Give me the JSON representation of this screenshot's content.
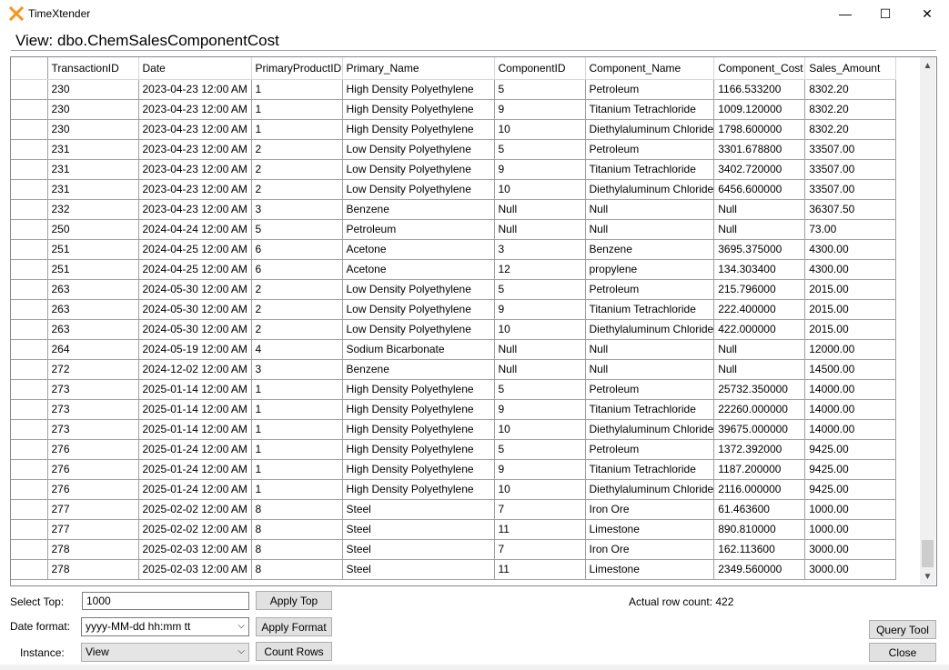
{
  "window": {
    "app_title": "TimeXtender",
    "minimize_glyph": "—",
    "maximize_glyph": "☐",
    "close_glyph": "✕",
    "logo_icon": "timextender-x-logo",
    "logo_color": "#f7941d"
  },
  "view": {
    "title": "View: dbo.ChemSalesComponentCost"
  },
  "grid": {
    "columns": [
      "TransactionID",
      "Date",
      "PrimaryProductID",
      "Primary_Name",
      "ComponentID",
      "Component_Name",
      "Component_Cost",
      "Sales_Amount"
    ],
    "rows": [
      [
        "230",
        "2023-04-23 12:00 AM",
        "1",
        "High Density Polyethylene",
        "5",
        "Petroleum",
        "1166.533200",
        "8302.20"
      ],
      [
        "230",
        "2023-04-23 12:00 AM",
        "1",
        "High Density Polyethylene",
        "9",
        "Titanium Tetrachloride",
        "1009.120000",
        "8302.20"
      ],
      [
        "230",
        "2023-04-23 12:00 AM",
        "1",
        "High Density Polyethylene",
        "10",
        "Diethylaluminum Chloride",
        "1798.600000",
        "8302.20"
      ],
      [
        "231",
        "2023-04-23 12:00 AM",
        "2",
        "Low Density Polyethylene",
        "5",
        "Petroleum",
        "3301.678800",
        "33507.00"
      ],
      [
        "231",
        "2023-04-23 12:00 AM",
        "2",
        "Low Density Polyethylene",
        "9",
        "Titanium Tetrachloride",
        "3402.720000",
        "33507.00"
      ],
      [
        "231",
        "2023-04-23 12:00 AM",
        "2",
        "Low Density Polyethylene",
        "10",
        "Diethylaluminum Chloride",
        "6456.600000",
        "33507.00"
      ],
      [
        "232",
        "2023-04-23 12:00 AM",
        "3",
        "Benzene",
        "Null",
        "Null",
        "Null",
        "36307.50"
      ],
      [
        "250",
        "2024-04-24 12:00 AM",
        "5",
        "Petroleum",
        "Null",
        "Null",
        "Null",
        "73.00"
      ],
      [
        "251",
        "2024-04-25 12:00 AM",
        "6",
        "Acetone",
        "3",
        "Benzene",
        "3695.375000",
        "4300.00"
      ],
      [
        "251",
        "2024-04-25 12:00 AM",
        "6",
        "Acetone",
        "12",
        "propylene",
        "134.303400",
        "4300.00"
      ],
      [
        "263",
        "2024-05-30 12:00 AM",
        "2",
        "Low Density Polyethylene",
        "5",
        "Petroleum",
        "215.796000",
        "2015.00"
      ],
      [
        "263",
        "2024-05-30 12:00 AM",
        "2",
        "Low Density Polyethylene",
        "9",
        "Titanium Tetrachloride",
        "222.400000",
        "2015.00"
      ],
      [
        "263",
        "2024-05-30 12:00 AM",
        "2",
        "Low Density Polyethylene",
        "10",
        "Diethylaluminum Chloride",
        "422.000000",
        "2015.00"
      ],
      [
        "264",
        "2024-05-19 12:00 AM",
        "4",
        "Sodium Bicarbonate",
        "Null",
        "Null",
        "Null",
        "12000.00"
      ],
      [
        "272",
        "2024-12-02 12:00 AM",
        "3",
        "Benzene",
        "Null",
        "Null",
        "Null",
        "14500.00"
      ],
      [
        "273",
        "2025-01-14 12:00 AM",
        "1",
        "High Density Polyethylene",
        "5",
        "Petroleum",
        "25732.350000",
        "14000.00"
      ],
      [
        "273",
        "2025-01-14 12:00 AM",
        "1",
        "High Density Polyethylene",
        "9",
        "Titanium Tetrachloride",
        "22260.000000",
        "14000.00"
      ],
      [
        "273",
        "2025-01-14 12:00 AM",
        "1",
        "High Density Polyethylene",
        "10",
        "Diethylaluminum Chloride",
        "39675.000000",
        "14000.00"
      ],
      [
        "276",
        "2025-01-24 12:00 AM",
        "1",
        "High Density Polyethylene",
        "5",
        "Petroleum",
        "1372.392000",
        "9425.00"
      ],
      [
        "276",
        "2025-01-24 12:00 AM",
        "1",
        "High Density Polyethylene",
        "9",
        "Titanium Tetrachloride",
        "1187.200000",
        "9425.00"
      ],
      [
        "276",
        "2025-01-24 12:00 AM",
        "1",
        "High Density Polyethylene",
        "10",
        "Diethylaluminum Chloride",
        "2116.000000",
        "9425.00"
      ],
      [
        "277",
        "2025-02-02 12:00 AM",
        "8",
        "Steel",
        "7",
        "Iron Ore",
        "61.463600",
        "1000.00"
      ],
      [
        "277",
        "2025-02-02 12:00 AM",
        "8",
        "Steel",
        "11",
        "Limestone",
        "890.810000",
        "1000.00"
      ],
      [
        "278",
        "2025-02-03 12:00 AM",
        "8",
        "Steel",
        "7",
        "Iron Ore",
        "162.113600",
        "3000.00"
      ],
      [
        "278",
        "2025-02-03 12:00 AM",
        "8",
        "Steel",
        "11",
        "Limestone",
        "2349.560000",
        "3000.00"
      ]
    ]
  },
  "controls": {
    "select_top_label": "Select Top:",
    "select_top_value": "1000",
    "apply_top_label": "Apply Top",
    "actual_row_count": "Actual row count: 422",
    "date_format_label": "Date format:",
    "date_format_value": "yyyy-MM-dd hh:mm tt",
    "apply_format_label": "Apply Format",
    "instance_label": "Instance:",
    "instance_value": "View",
    "count_rows_label": "Count Rows",
    "query_tool_label": "Query Tool",
    "close_label": "Close"
  },
  "icons": {
    "scroll_up": "▲",
    "scroll_down": "▼",
    "dropdown": "⌵"
  }
}
